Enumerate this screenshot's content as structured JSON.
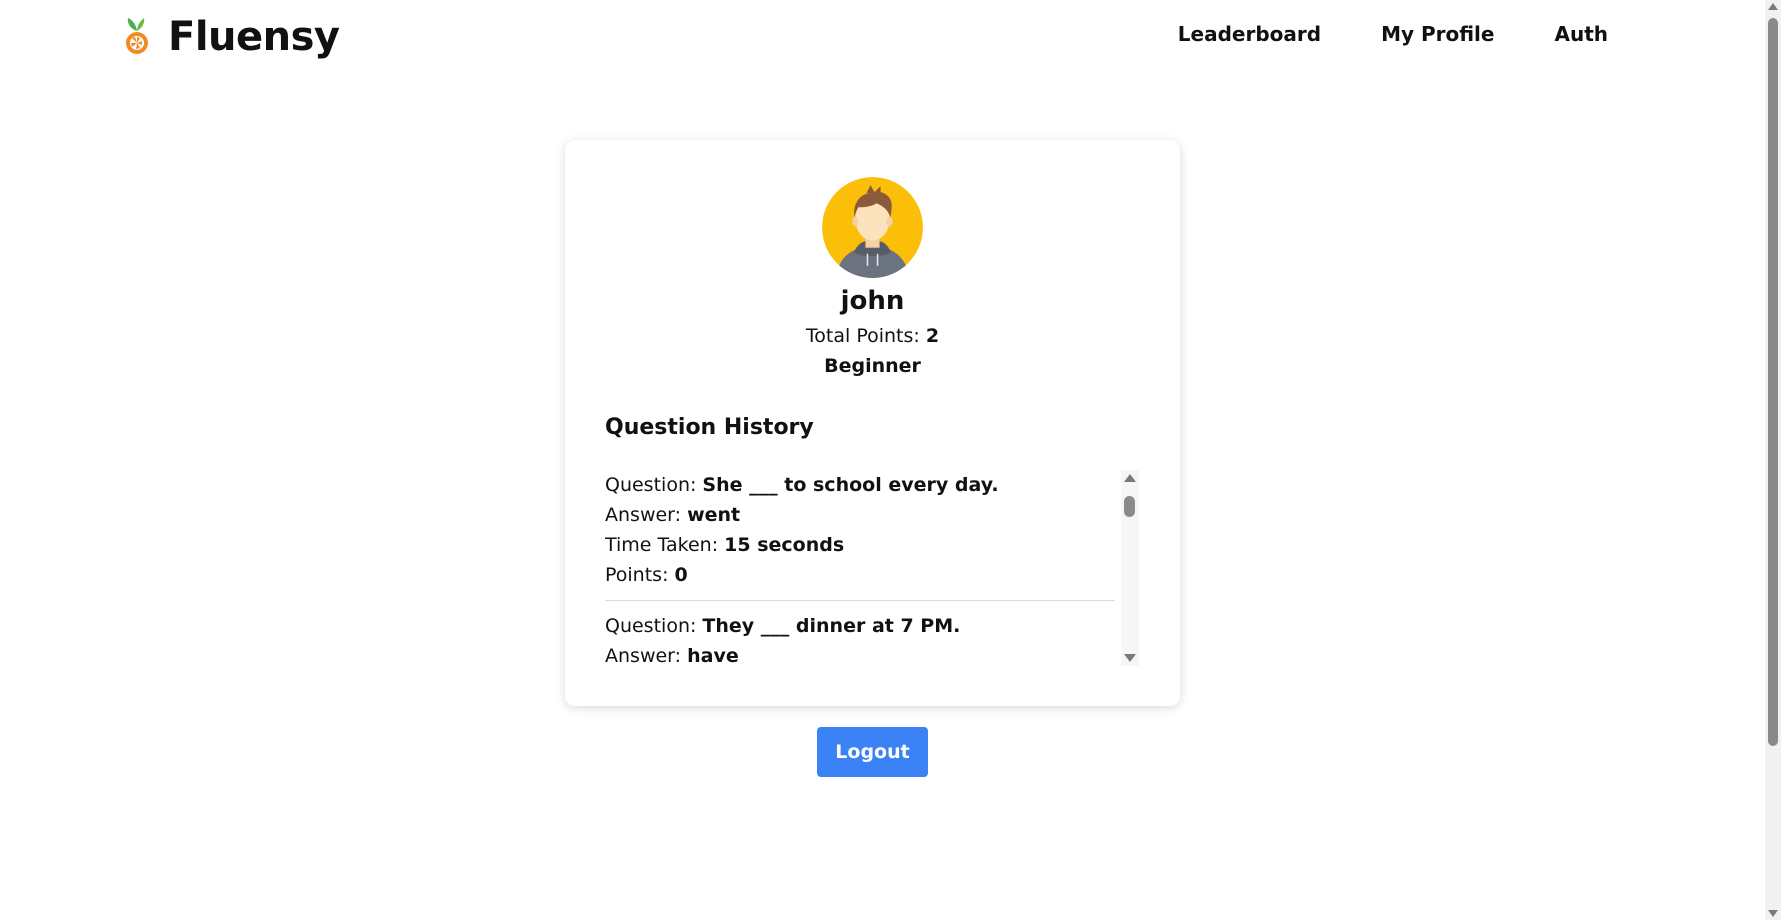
{
  "header": {
    "brand_name": "Fluensy",
    "logo_icon": "citrus-logo-icon",
    "nav": [
      {
        "label": "Leaderboard"
      },
      {
        "label": "My Profile"
      },
      {
        "label": "Auth"
      }
    ]
  },
  "profile": {
    "avatar_icon": "user-avatar-icon",
    "username": "john",
    "points_label": "Total Points: ",
    "points_value": "2",
    "level": "Beginner"
  },
  "history": {
    "title": "Question History",
    "items": [
      {
        "question_label": "Question: ",
        "question": "She ___ to school every day.",
        "answer_label": "Answer: ",
        "answer": "went",
        "time_label": "Time Taken: ",
        "time": "15 seconds",
        "points_label": "Points: ",
        "points": "0"
      },
      {
        "question_label": "Question: ",
        "question": "They ___ dinner at 7 PM.",
        "answer_label": "Answer: ",
        "answer": "have"
      }
    ]
  },
  "logout_label": "Logout",
  "colors": {
    "primary": "#3b82f6",
    "avatar_bg": "#fbbf0a",
    "logo_orange": "#f08a24",
    "logo_green": "#4caf50"
  }
}
